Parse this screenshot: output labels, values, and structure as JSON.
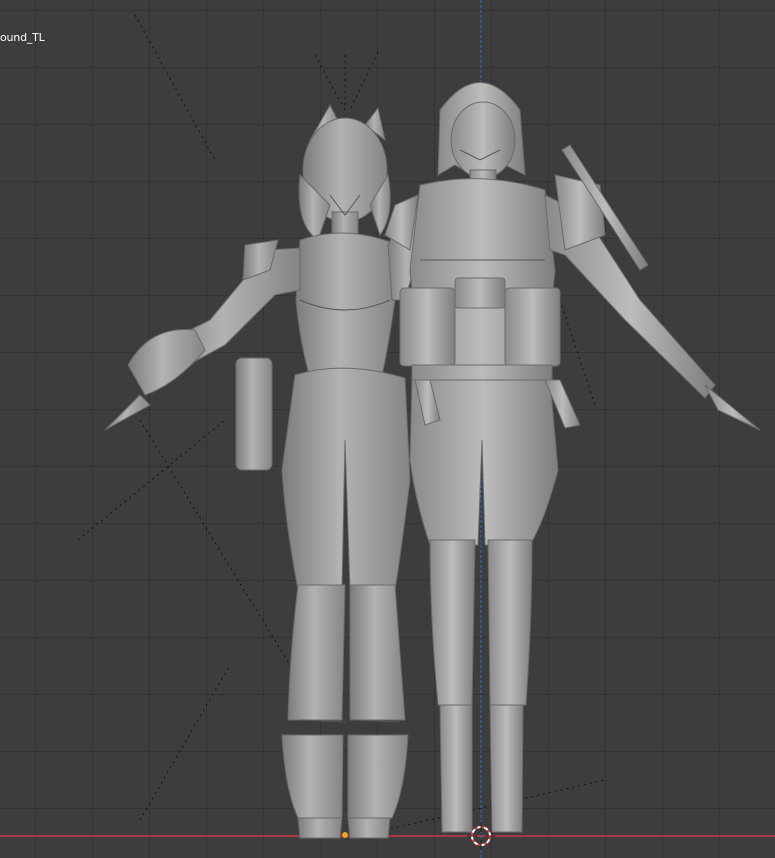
{
  "viewport": {
    "object_label": "ound_TL",
    "axis_colors": {
      "x_axis": "#a33a44",
      "z_axis": "#2f6fc6"
    },
    "background": "#3d3d3d",
    "grid_color": "#333333",
    "model_color": "#9a9a9a",
    "origin_marker": "3d-cursor-icon"
  }
}
